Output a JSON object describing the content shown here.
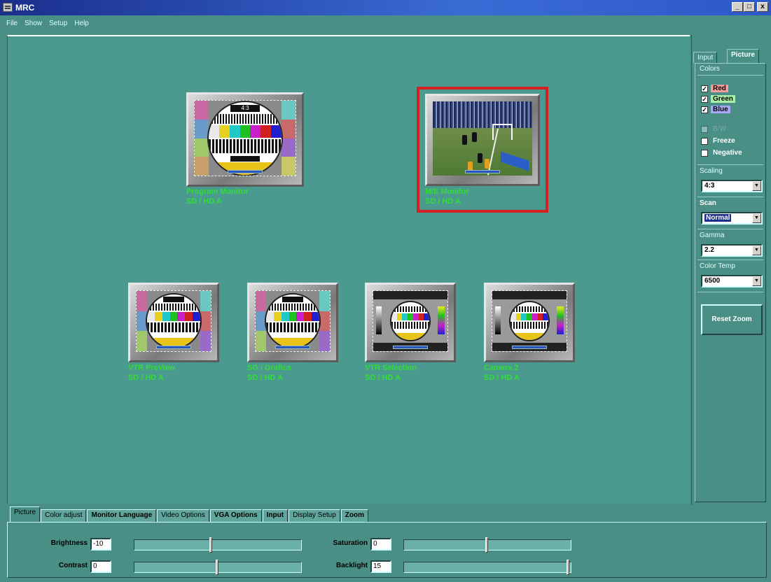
{
  "window": {
    "title": "MRC",
    "buttons": [
      "_",
      "□",
      "x"
    ]
  },
  "menu": [
    "File",
    "Show",
    "Setup",
    "Help"
  ],
  "monitors": [
    {
      "id": "program",
      "name": "Program Monitor",
      "source": "SD / HD A",
      "content": "test-pattern-round",
      "selected": false
    },
    {
      "id": "me",
      "name": "M/E Monitor",
      "source": "SD / HD A",
      "content": "football-match",
      "selected": true
    },
    {
      "id": "vtr-preview",
      "name": "VTR PreView",
      "source": "SD / HD A",
      "content": "test-pattern-round",
      "selected": false
    },
    {
      "id": "sg-grafics",
      "name": "SG / Grafics",
      "source": "SD / HD A",
      "content": "test-pattern-round",
      "selected": false
    },
    {
      "id": "vtr-selection",
      "name": "VTR Selection",
      "source": "SD / HD A",
      "content": "test-pattern-wide",
      "selected": false
    },
    {
      "id": "camera2",
      "name": "Camera 2",
      "source": "SD / HD A",
      "content": "test-pattern-wide",
      "selected": false
    }
  ],
  "test_pattern_label": "4:3",
  "right_panel": {
    "tabs": [
      "Input",
      "Picture"
    ],
    "active_tab": "Picture",
    "colors_label": "Colors",
    "colors": [
      {
        "label": "Red",
        "checked": true,
        "color": "#f4a0a0"
      },
      {
        "label": "Green",
        "checked": true,
        "color": "#a8f0a8"
      },
      {
        "label": "Blue",
        "checked": true,
        "color": "#a8a8f4"
      }
    ],
    "options": [
      {
        "label": "B/W",
        "checked": false,
        "disabled": true
      },
      {
        "label": "Freeze",
        "checked": false,
        "disabled": false
      },
      {
        "label": "Negative",
        "checked": false,
        "disabled": false
      }
    ],
    "scaling": {
      "label": "Scaling",
      "value": "4:3"
    },
    "scan": {
      "label": "Scan",
      "value": "Normal"
    },
    "gamma": {
      "label": "Gamma",
      "value": "2.2"
    },
    "color_temp": {
      "label": "Color Temp",
      "value": "6500"
    },
    "reset_zoom": "Reset Zoom"
  },
  "bottom_tabs": [
    "Picture",
    "Color adjust",
    "Monitor Language",
    "Video Options",
    "VGA Options",
    "Input",
    "Display Setup",
    "Zoom"
  ],
  "bottom_active_tab": "Picture",
  "sliders": [
    {
      "label": "Brightness",
      "value": "-10",
      "fraction": 0.46
    },
    {
      "label": "Saturation",
      "value": "0",
      "fraction": 0.5
    },
    {
      "label": "Contrast",
      "value": "0",
      "fraction": 0.5
    },
    {
      "label": "Backlight",
      "value": "15",
      "fraction": 1.0
    }
  ],
  "colors": {
    "background": "#4a9a90",
    "selected_border": "#d42020",
    "monitor_label": "#33dd33"
  }
}
